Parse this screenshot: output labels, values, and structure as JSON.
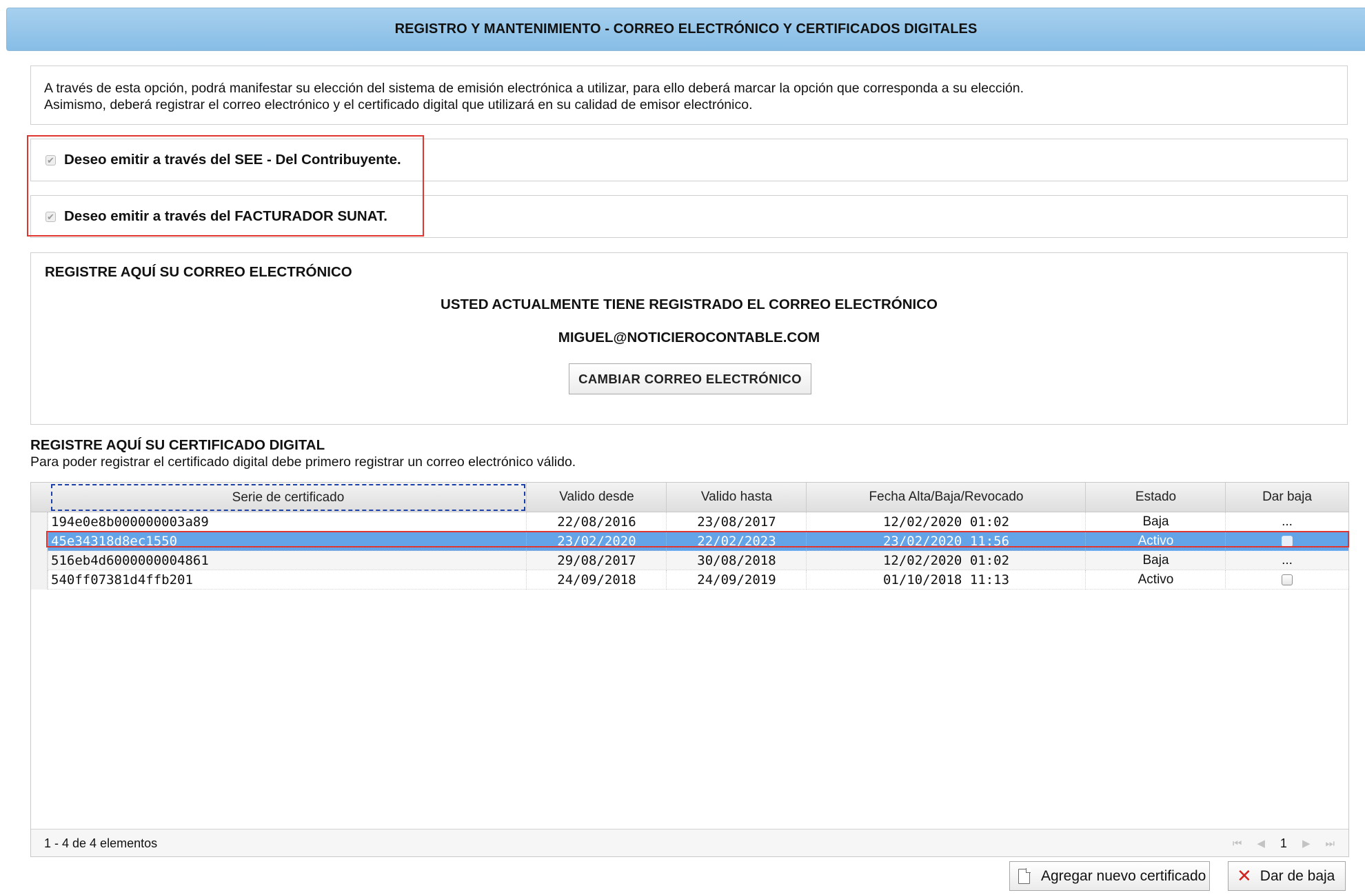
{
  "header": {
    "title": "REGISTRO Y MANTENIMIENTO - CORREO ELECTRÓNICO Y CERTIFICADOS DIGITALES"
  },
  "intro": {
    "line1": "A través de esta opción, podrá manifestar su elección del sistema de emisión electrónica a utilizar, para ello deberá marcar la opción que corresponda a su elección.",
    "line2": "Asimismo, deberá registrar el correo electrónico y el certificado digital que utilizará en su calidad de emisor electrónico."
  },
  "options": [
    {
      "label": "Deseo emitir a través del SEE - Del Contribuyente.",
      "checked": true
    },
    {
      "label": "Deseo emitir a través del FACTURADOR SUNAT.",
      "checked": true
    }
  ],
  "email": {
    "section_title": "REGISTRE AQUÍ SU CORREO ELECTRÓNICO",
    "status_text": "USTED ACTUALMENTE TIENE REGISTRADO EL CORREO ELECTRÓNICO",
    "address": "MIGUEL@NOTICIEROCONTABLE.COM",
    "change_button": "CAMBIAR CORREO ELECTRÓNICO"
  },
  "certificate": {
    "section_title": "REGISTRE AQUÍ SU CERTIFICADO DIGITAL",
    "subtitle": "Para poder registrar el certificado digital debe primero registrar un correo electrónico válido.",
    "columns": [
      "Serie de certificado",
      "Valido desde",
      "Valido hasta",
      "Fecha Alta/Baja/Revocado",
      "Estado",
      "Dar baja"
    ],
    "rows": [
      {
        "serie": "194e0e8b000000003a89",
        "desde": "22/08/2016",
        "hasta": "23/08/2017",
        "fecha": "12/02/2020 01:02",
        "estado": "Baja",
        "accion": "...",
        "selected": false
      },
      {
        "serie": "45e34318d8ec1550",
        "desde": "23/02/2020",
        "hasta": "22/02/2023",
        "fecha": "23/02/2020 11:56",
        "estado": "Activo",
        "accion": "checkbox",
        "selected": true
      },
      {
        "serie": "516eb4d6000000004861",
        "desde": "29/08/2017",
        "hasta": "30/08/2018",
        "fecha": "12/02/2020 01:02",
        "estado": "Baja",
        "accion": "...",
        "selected": false
      },
      {
        "serie": "540ff07381d4ffb201",
        "desde": "24/09/2018",
        "hasta": "24/09/2019",
        "fecha": "01/10/2018 11:13",
        "estado": "Activo",
        "accion": "checkbox",
        "selected": false
      }
    ],
    "pager_info": "1 - 4 de 4 elementos",
    "current_page": "1"
  },
  "buttons": {
    "add": "Agregar nuevo certificado",
    "remove": "Dar de baja"
  },
  "icons": {
    "add_button": "document-icon",
    "remove_button": "close-x-icon",
    "pager": [
      "first-page-icon",
      "prev-page-icon",
      "next-page-icon",
      "last-page-icon"
    ]
  },
  "colors": {
    "header_bg": "#87bde6",
    "selected_row": "#63a3e8",
    "highlight_outline": "#e0342f",
    "remove_icon": "#d1241f"
  }
}
